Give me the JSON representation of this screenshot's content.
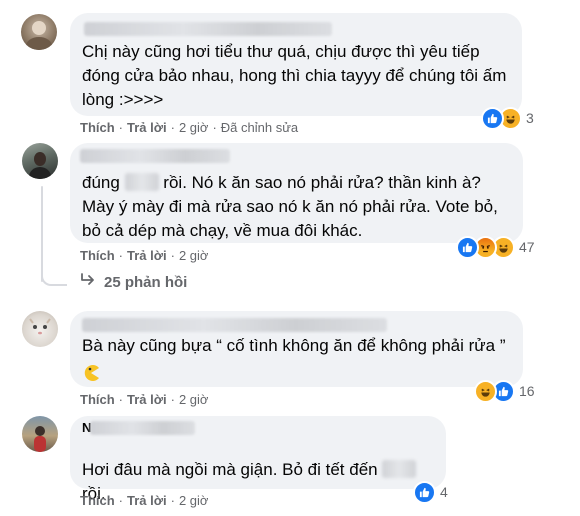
{
  "comments": [
    {
      "text": "Chị này cũng hơi tiểu thư quá, chịu được thì yêu tiếp đóng cửa bảo nhau, hong thì chia tayyy để chúng tôi ấm lòng :>>>>",
      "like_label": "Thích",
      "reply_label": "Trả lời",
      "time": "2 giờ",
      "extra": "Đã chỉnh sửa",
      "reactions": [
        "like",
        "haha"
      ],
      "reaction_count": "3"
    },
    {
      "text_a": "đúng",
      "text_b": "rồi. Nó k ăn sao nó phải rửa? thần kinh à? Mày ý mày đi mà rửa sao nó k ăn nó phải rửa. Vote bỏ, bỏ cả dép mà chạy, về mua đôi khác.",
      "like_label": "Thích",
      "reply_label": "Trả lời",
      "time": "2 giờ",
      "reactions": [
        "like",
        "haha",
        "angry"
      ],
      "reaction_count": "47",
      "replies_label": "25 phản hồi"
    },
    {
      "text": "Bà này cũng bựa “ cố tình không ăn để không phải rửa ”",
      "emoji": "pacman",
      "like_label": "Thích",
      "reply_label": "Trả lời",
      "time": "2 giờ",
      "reactions": [
        "haha",
        "like"
      ],
      "reaction_count": "16"
    },
    {
      "name_visible": "N",
      "text_a": "Hơi đâu mà ngồi mà giận. Bỏ đi tết đến",
      "text_b": "rồi.",
      "like_label": "Thích",
      "reply_label": "Trả lời",
      "time": "2 giờ",
      "reactions": [
        "like"
      ],
      "reaction_count": "4"
    }
  ],
  "colors": {
    "bubble": "#f0f2f5",
    "meta": "#65676b",
    "like": "#1877f2",
    "haha": "#f7b125"
  }
}
